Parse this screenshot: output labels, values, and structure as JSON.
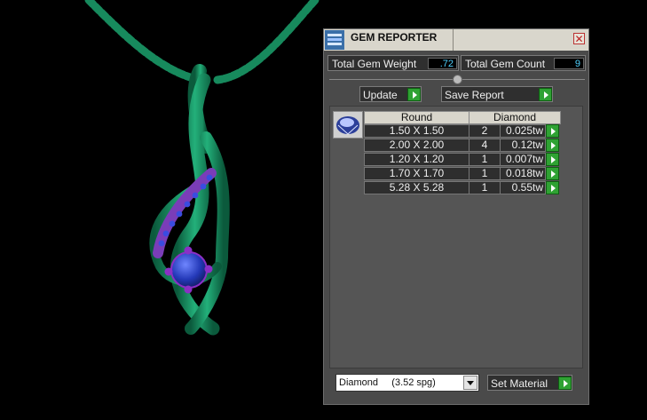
{
  "panel": {
    "title": "GEM REPORTER",
    "close_label": "✕",
    "total_gem_weight_label": "Total Gem Weight",
    "total_gem_weight_value": ".72",
    "total_gem_count_label": "Total Gem Count",
    "total_gem_count_value": "9",
    "update_label": "Update",
    "save_report_label": "Save Report",
    "table": {
      "headers": [
        "Round",
        "Diamond"
      ],
      "rows": [
        {
          "size": "1.50 X 1.50",
          "count": "2",
          "weight": "0.025tw"
        },
        {
          "size": "2.00 X 2.00",
          "count": "4",
          "weight": "0.12tw"
        },
        {
          "size": "1.20 X 1.20",
          "count": "1",
          "weight": "0.007tw"
        },
        {
          "size": "1.70 X 1.70",
          "count": "1",
          "weight": "0.018tw"
        },
        {
          "size": "5.28 X 5.28",
          "count": "1",
          "weight": "0.55tw"
        }
      ]
    },
    "material_select_value": "Diamond     (3.52 spg)",
    "set_material_label": "Set Material"
  },
  "colors": {
    "metal": "#1f9e6e",
    "side_stones": "#5a3fd1",
    "center_stone": "#2439b8",
    "prongs": "#8b2fc6"
  },
  "icons": {
    "title": "gem-reporter-app-icon",
    "arrows": "green-play-arrow-icon",
    "dropdown": "chevron-down-icon"
  }
}
